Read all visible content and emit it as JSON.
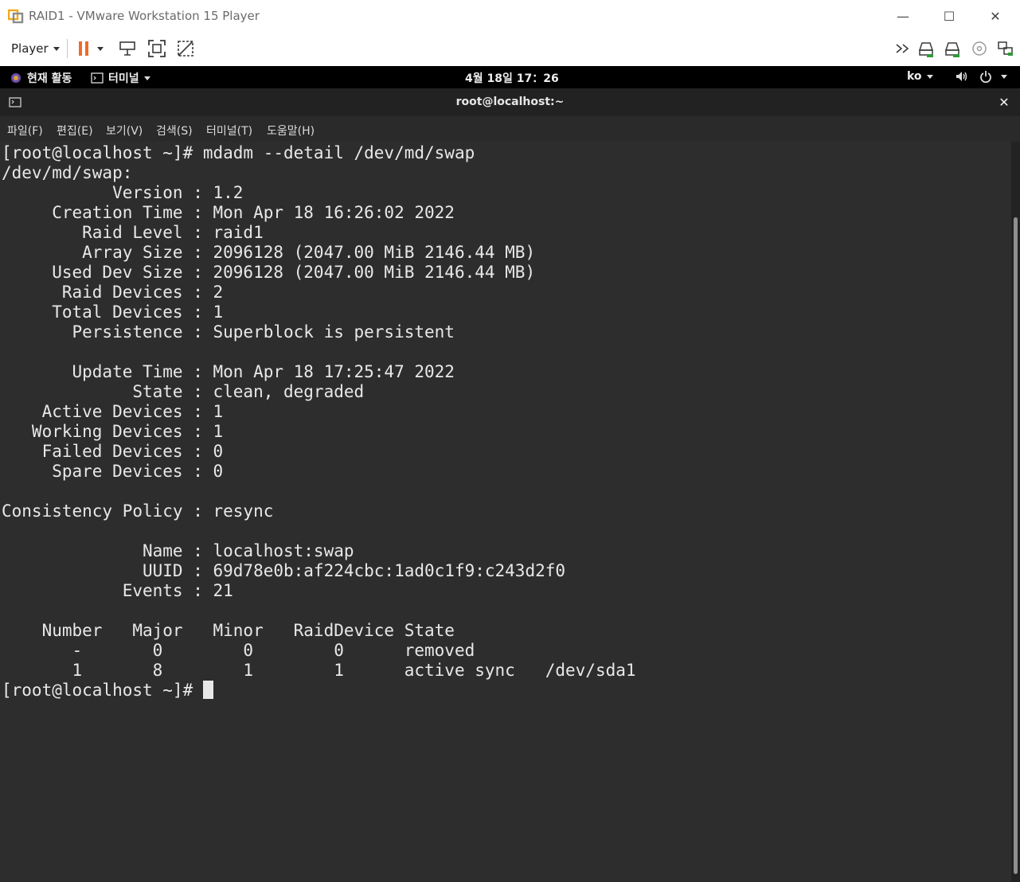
{
  "window": {
    "title": "RAID1 - VMware Workstation 15 Player",
    "controls": [
      "—",
      "☐",
      "✕"
    ]
  },
  "player_toolbar": {
    "menu_label": "Player",
    "colors": {
      "pause": "#f06a2a",
      "icon": "#3a3a3a"
    }
  },
  "gnome_topbar": {
    "activities": "현재 활동",
    "app_menu": "터미널",
    "clock": "4월 18일  17：26",
    "language": "ko"
  },
  "terminal": {
    "title": "root@localhost:~",
    "menus": [
      "파일(F)",
      "편집(E)",
      "보기(V)",
      "검색(S)",
      "터미널(T)",
      "도움말(H)"
    ],
    "lines": [
      "[root@localhost ~]# mdadm --detail /dev/md/swap",
      "/dev/md/swap:",
      "           Version : 1.2",
      "     Creation Time : Mon Apr 18 16:26:02 2022",
      "        Raid Level : raid1",
      "        Array Size : 2096128 (2047.00 MiB 2146.44 MB)",
      "     Used Dev Size : 2096128 (2047.00 MiB 2146.44 MB)",
      "      Raid Devices : 2",
      "     Total Devices : 1",
      "       Persistence : Superblock is persistent",
      "",
      "       Update Time : Mon Apr 18 17:25:47 2022",
      "             State : clean, degraded",
      "    Active Devices : 1",
      "   Working Devices : 1",
      "    Failed Devices : 0",
      "     Spare Devices : 0",
      "",
      "Consistency Policy : resync",
      "",
      "              Name : localhost:swap",
      "              UUID : 69d78e0b:af224cbc:1ad0c1f9:c243d2f0",
      "            Events : 21",
      "",
      "    Number   Major   Minor   RaidDevice State",
      "       -       0        0        0      removed",
      "       1       8        1        1      active sync   /dev/sda1"
    ],
    "prompt": "[root@localhost ~]# "
  }
}
